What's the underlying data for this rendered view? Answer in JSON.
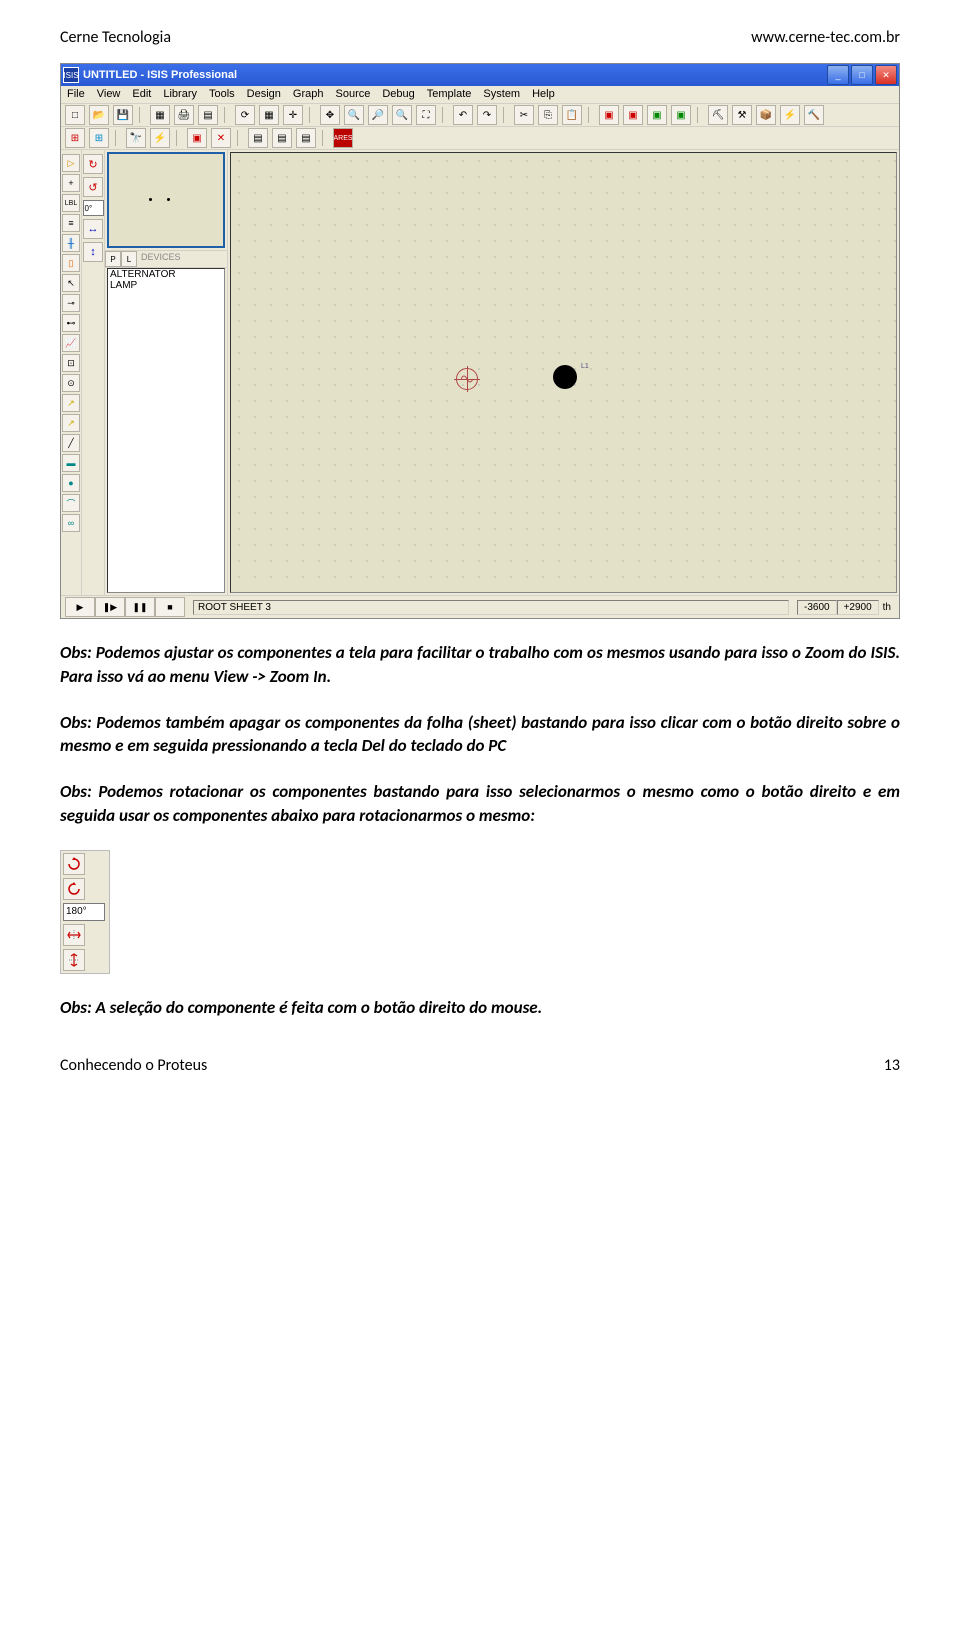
{
  "header": {
    "left": "Cerne Tecnologia",
    "right": "www.cerne-tec.com.br"
  },
  "window": {
    "title": "UNTITLED - ISIS Professional",
    "appicon": "ISIS",
    "menus": [
      "File",
      "View",
      "Edit",
      "Library",
      "Tools",
      "Design",
      "Graph",
      "Source",
      "Debug",
      "Template",
      "System",
      "Help"
    ],
    "rotation_deg": "0°",
    "devices_label": "DEVICES",
    "pl": {
      "p": "P",
      "l": "L"
    },
    "parts": [
      "ALTERNATOR",
      "LAMP"
    ],
    "component_label": "L1",
    "status": {
      "sheet": "ROOT SHEET 3",
      "x": "-3600",
      "y": "+2900",
      "unit": "th"
    }
  },
  "paragraphs": {
    "p1": "Obs: Podemos ajustar os componentes a tela para facilitar o trabalho com os mesmos usando para isso o Zoom do ISIS. Para isso vá ao menu View -> Zoom In.",
    "p2": "Obs: Podemos também apagar os componentes da folha (sheet) bastando para isso clicar com o botão direito sobre o mesmo e em seguida pressionando a tecla Del do teclado do PC",
    "p3": "Obs: Podemos rotacionar os componentes bastando para isso selecionarmos o mesmo como o botão direito e em seguida usar os componentes abaixo para rotacionarmos o mesmo:",
    "p4": "Obs: A seleção do componente é feita com o botão direito do mouse."
  },
  "rotwidget": {
    "deg": "180°"
  },
  "footer": {
    "left": "Conhecendo o Proteus",
    "right": "13"
  }
}
